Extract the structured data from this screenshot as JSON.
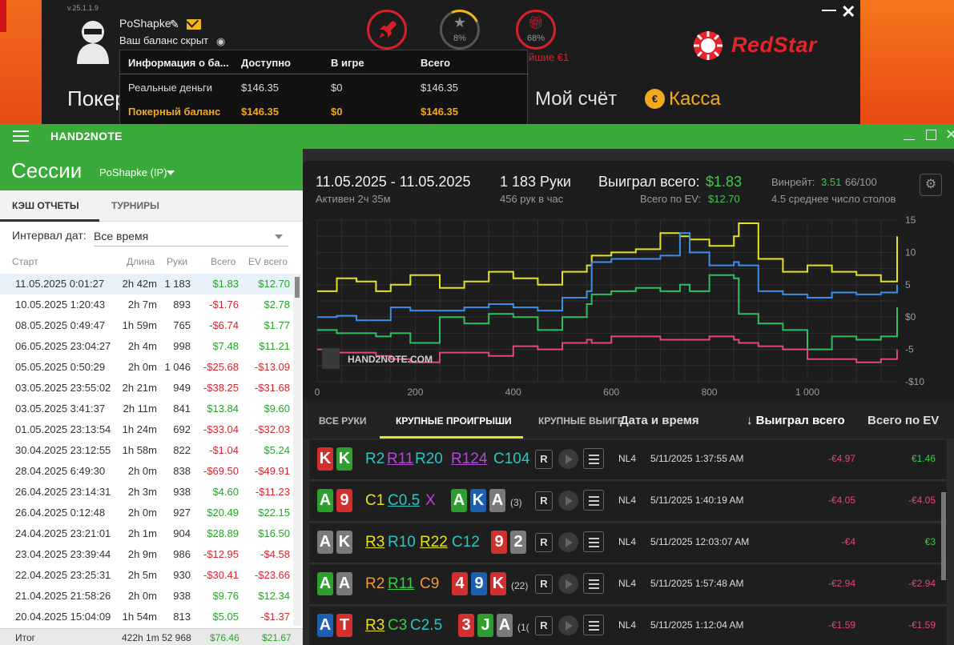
{
  "redstar": {
    "version": "v.25.1.1.9",
    "username": "PoShapke",
    "balance_hidden": "Ваш баланс скрыт",
    "star_pct": "8%",
    "gift_pct": "68%",
    "promo": "йшие €1",
    "logo": "RedStar",
    "nav_poker": "Покер",
    "nav_account": "Мой счёт",
    "nav_cashier": "Касса",
    "popup": {
      "headers": [
        "Информация о ба...",
        "Доступно",
        "В игре",
        "Всего"
      ],
      "rows": [
        [
          "Реальные деньги",
          "$146.35",
          "$0",
          "$146.35"
        ],
        [
          "Покерный баланс",
          "$146.35",
          "$0",
          "$146.35"
        ]
      ]
    },
    "colors": {
      "brand": "#e8222b",
      "accent": "#f2a91c"
    }
  },
  "app": {
    "title": "HAND2NOTE",
    "sessions_title": "Сессии",
    "player": "PoShapke (IP)",
    "tabs": [
      "КЭШ ОТЧЕТЫ",
      "ТУРНИРЫ"
    ],
    "interval_label": "Интервал дат:",
    "interval_value": "Все время",
    "columns": [
      "Старт",
      "Длина",
      "Руки",
      "Всего",
      "EV всего"
    ],
    "sessions": [
      [
        "11.05.2025 0:01:27",
        "2h 42m",
        "1 183",
        "$1.83",
        "$12.70"
      ],
      [
        "10.05.2025 1:20:43",
        "2h 7m",
        "893",
        "-$1.76",
        "$2.78"
      ],
      [
        "08.05.2025 0:49:47",
        "1h 59m",
        "765",
        "-$6.74",
        "$1.77"
      ],
      [
        "06.05.2025 23:04:27",
        "2h 4m",
        "998",
        "$7.48",
        "$11.21"
      ],
      [
        "05.05.2025 0:50:29",
        "2h 0m",
        "1 046",
        "-$25.68",
        "-$13.09"
      ],
      [
        "03.05.2025 23:55:02",
        "2h 21m",
        "949",
        "-$38.25",
        "-$31.68"
      ],
      [
        "03.05.2025 3:41:37",
        "2h 11m",
        "841",
        "$13.84",
        "$9.60"
      ],
      [
        "01.05.2025 23:13:54",
        "1h 24m",
        "692",
        "-$33.04",
        "-$32.03"
      ],
      [
        "30.04.2025 23:12:55",
        "1h 58m",
        "822",
        "-$1.04",
        "$5.24"
      ],
      [
        "28.04.2025 6:49:30",
        "2h 0m",
        "838",
        "-$69.50",
        "-$49.91"
      ],
      [
        "26.04.2025 23:14:31",
        "2h 3m",
        "938",
        "$4.60",
        "-$11.23"
      ],
      [
        "26.04.2025 0:12:48",
        "2h 0m",
        "927",
        "$20.49",
        "$22.15"
      ],
      [
        "24.04.2025 23:21:01",
        "2h 1m",
        "904",
        "$28.89",
        "$16.50"
      ],
      [
        "23.04.2025 23:39:44",
        "2h 9m",
        "986",
        "-$12.95",
        "-$4.58"
      ],
      [
        "22.04.2025 23:25:31",
        "2h 5m",
        "930",
        "-$30.41",
        "-$23.66"
      ],
      [
        "21.04.2025 21:58:26",
        "2h 0m",
        "938",
        "$9.76",
        "$12.34"
      ],
      [
        "20.04.2025 15:04:09",
        "1h 54m",
        "813",
        "$5.05",
        "-$1.37"
      ]
    ],
    "totals": {
      "label": "Итог",
      "length": "422h 1m",
      "hands": "52 968",
      "won": "$76.46",
      "ev": "$21.67"
    },
    "stats": {
      "date_range": "11.05.2025 - 11.05.2025",
      "active": "Активен 2ч 35м",
      "hands": "1 183 Руки",
      "per_hour": "456 рук в час",
      "won_label": "Выиграл всего:",
      "won_value": "$1.83",
      "ev_label": "Всего по EV:",
      "ev_value": "$12.70",
      "winrate_label": "Винрейт:",
      "winrate_value": "3.51",
      "winrate_unit": "66/100",
      "tables": "4.5 среднее число столов",
      "watermark": "HAND2NOTE.COM"
    },
    "hand_tabs": [
      "ВСЕ РУКИ",
      "КРУПНЫЕ ПРОИГРЫШИ",
      "КРУПНЫЕ ВЫИГР"
    ],
    "hand_headers": [
      "Дата и время",
      "↓ Выиграл всего",
      "Всего по EV"
    ],
    "hands": [
      {
        "stake": "NL4",
        "date": "5/11/2025 1:37:55 AM",
        "won": "-€4.97",
        "ev": "€1.46"
      },
      {
        "stake": "NL4",
        "date": "5/11/2025 1:40:19 AM",
        "won": "-€4.05",
        "ev": "-€4.05"
      },
      {
        "stake": "NL4",
        "date": "5/11/2025 12:03:07 AM",
        "won": "-€4",
        "ev": "€3"
      },
      {
        "stake": "NL4",
        "date": "5/11/2025 1:57:48 AM",
        "won": "-€2.94",
        "ev": "-€2.94"
      },
      {
        "stake": "NL4",
        "date": "5/11/2025 1:12:04 AM",
        "won": "-€1.59",
        "ev": "-€1.59"
      }
    ],
    "hand_actions": [
      {
        "cards": [
          "K",
          "K"
        ],
        "acts": [
          "R2",
          "R11",
          "R20",
          "R124",
          "C104"
        ],
        "board": [],
        "extra": ""
      },
      {
        "cards": [
          "A",
          "9"
        ],
        "acts": [
          "C1",
          "C0.5",
          "X"
        ],
        "board": [
          "A",
          "K",
          "A"
        ],
        "extra": "(3)"
      },
      {
        "cards": [
          "A",
          "K"
        ],
        "acts": [
          "R3",
          "R10",
          "R22",
          "C12"
        ],
        "board": [
          "9",
          "2"
        ],
        "extra": ""
      },
      {
        "cards": [
          "A",
          "A"
        ],
        "acts": [
          "R2",
          "R11",
          "C9"
        ],
        "board": [
          "4",
          "9",
          "K"
        ],
        "extra": "(22)"
      },
      {
        "cards": [
          "A",
          "T"
        ],
        "acts": [
          "R3",
          "C3",
          "C2.5"
        ],
        "board": [
          "3",
          "J",
          "A"
        ],
        "extra": "(1("
      }
    ],
    "r_button": "R"
  },
  "chart_data": {
    "type": "line",
    "x_ticks": [
      "0",
      "200",
      "400",
      "600",
      "800",
      "1 000"
    ],
    "y_ticks": [
      "15",
      "10",
      "5",
      "$0",
      "-5",
      "-$10"
    ],
    "xlim": [
      0,
      1183
    ],
    "ylim": [
      -10,
      15
    ],
    "series": [
      {
        "color": "#e6e21c",
        "x": [
          0,
          40,
          80,
          120,
          150,
          190,
          250,
          300,
          350,
          400,
          450,
          500,
          550,
          560,
          600,
          650,
          700,
          740,
          760,
          800,
          850,
          860,
          900,
          950,
          1000,
          1050,
          1100,
          1150,
          1183
        ],
        "y": [
          4,
          6,
          5.5,
          4,
          5,
          6.5,
          4.5,
          5.5,
          7,
          6,
          5,
          7,
          8,
          9.5,
          10,
          10.5,
          13,
          12.5,
          12,
          11,
          12.5,
          14.5,
          9,
          7,
          8,
          7,
          6.5,
          5.5,
          12.5
        ]
      },
      {
        "color": "#3c8ee8",
        "x": [
          0,
          40,
          80,
          120,
          150,
          190,
          250,
          300,
          350,
          400,
          450,
          500,
          550,
          560,
          600,
          650,
          700,
          740,
          760,
          800,
          850,
          860,
          900,
          950,
          1000,
          1050,
          1100,
          1150,
          1183
        ],
        "y": [
          0,
          0.2,
          -0.5,
          -0.5,
          1.5,
          1,
          1,
          1.5,
          2,
          1.5,
          1,
          3,
          4,
          8.5,
          9,
          9,
          9.5,
          13,
          10,
          8,
          8.5,
          8,
          4,
          3.5,
          3,
          3.8,
          3.5,
          3.8,
          5
        ]
      },
      {
        "color": "#2fbf5f",
        "x": [
          0,
          40,
          80,
          120,
          150,
          190,
          250,
          300,
          350,
          400,
          450,
          500,
          550,
          560,
          600,
          650,
          700,
          740,
          760,
          800,
          850,
          860,
          900,
          950,
          1000,
          1050,
          1100,
          1150,
          1183
        ],
        "y": [
          -2,
          -2.5,
          -2.5,
          -3,
          -2.5,
          -4,
          0,
          -1,
          0.5,
          0,
          -2,
          0,
          2,
          3.5,
          4,
          4.5,
          4,
          5,
          4,
          6.5,
          6,
          0.5,
          -1,
          -2,
          -5,
          -3,
          -3.5,
          -3,
          1.5
        ]
      },
      {
        "color": "#e0487a",
        "x": [
          0,
          40,
          80,
          120,
          150,
          190,
          250,
          300,
          350,
          400,
          450,
          500,
          550,
          560,
          600,
          650,
          700,
          740,
          760,
          800,
          850,
          860,
          900,
          950,
          1000,
          1050,
          1100,
          1150,
          1183
        ],
        "y": [
          -5,
          -5.5,
          -5.5,
          -6,
          -6.5,
          -7,
          -5.5,
          -5.5,
          -6,
          -4.5,
          -5,
          -4,
          -3.5,
          -4,
          -3,
          -3,
          -3.5,
          -3.5,
          -3.5,
          -3,
          -3.5,
          -4,
          -4.5,
          -5,
          -6.5,
          -6.5,
          -7,
          -6.5,
          -5
        ]
      }
    ],
    "grid": true
  }
}
